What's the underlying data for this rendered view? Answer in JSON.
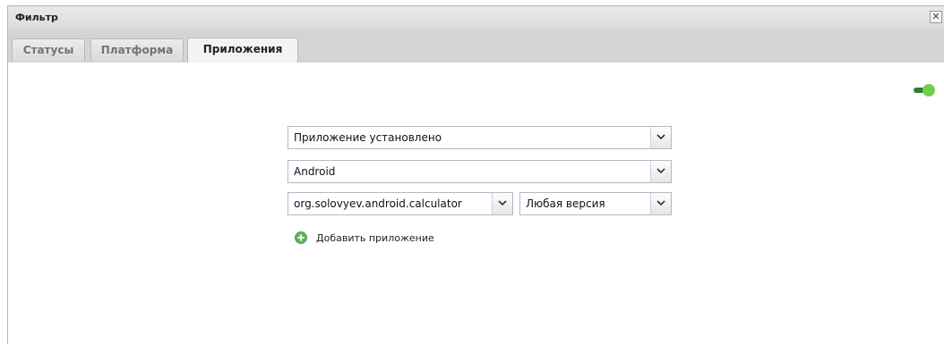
{
  "window": {
    "title": "Фильтр",
    "close_glyph": "✕"
  },
  "tabs": [
    {
      "label": "Статусы",
      "active": false
    },
    {
      "label": "Платформа",
      "active": false
    },
    {
      "label": "Приложения",
      "active": true
    }
  ],
  "toggle": {
    "state": "on",
    "color": "#6fd04e"
  },
  "filters": {
    "condition": {
      "value": "Приложение установлено"
    },
    "platform": {
      "value": "Android"
    },
    "application": {
      "value": "org.solovyev.android.calculator"
    },
    "version": {
      "value": "Любая версия"
    }
  },
  "add_app": {
    "label": "Добавить приложение",
    "icon": "plus-circle-icon",
    "color": "#5cb85c"
  }
}
